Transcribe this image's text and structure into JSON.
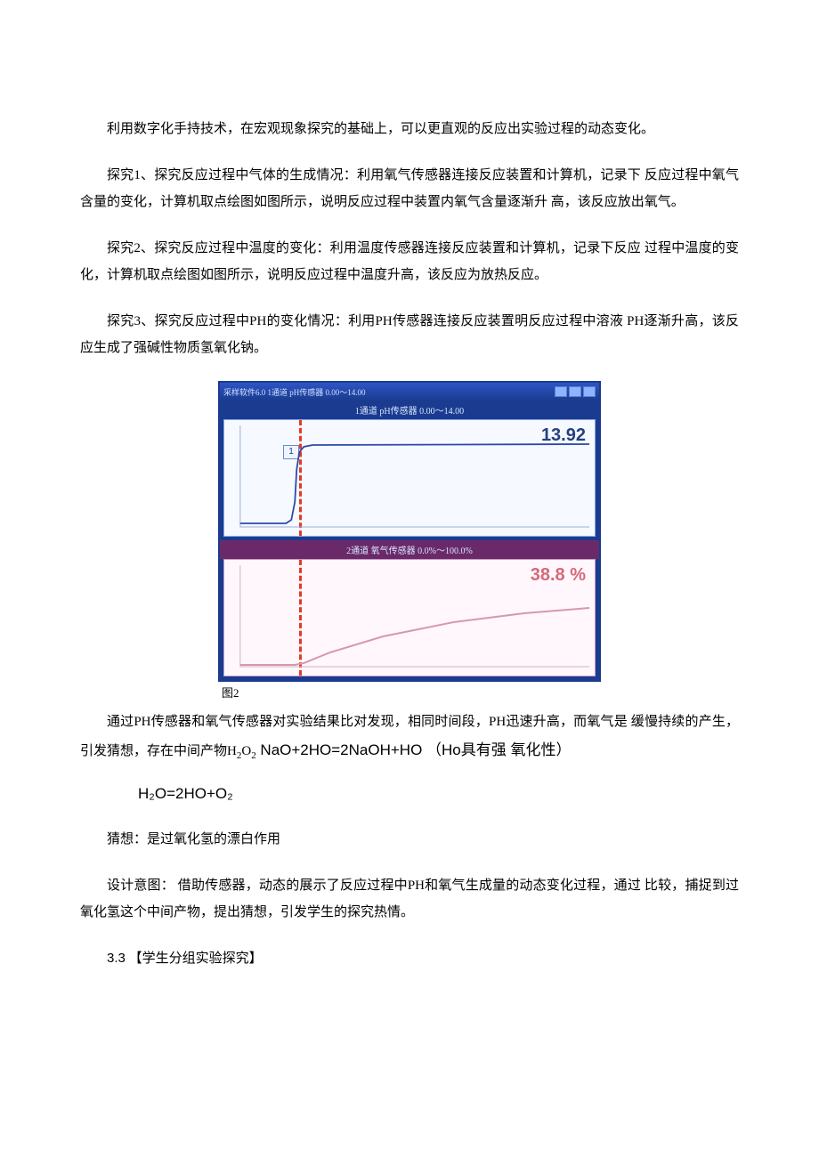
{
  "paras": {
    "p1": "利用数字化手持技术，在宏观现象探究的基础上，可以更直观的反应出实验过程的动态变化。",
    "p2": "探究1、探究反应过程中气体的生成情况：利用氧气传感器连接反应装置和计算机，记录下 反应过程中氧气含量的变化，计算机取点绘图如图所示，说明反应过程中装置内氧气含量逐渐升  高，该反应放出氧气。",
    "p3": "探究2、探究反应过程中温度的变化：利用温度传感器连接反应装置和计算机，记录下反应 过程中温度的变化，计算机取点绘图如图所示，说明反应过程中温度升高，该反应为放热反应。",
    "p4": "探究3、探究反应过程中PH的变化情况：利用PH传感器连接反应装置明反应过程中溶液 PH逐渐升高，该反应生成了强碱性物质氢氧化钠。",
    "fig_caption": "图2",
    "p5_a": "通过PH传感器和氧气传感器对实验结果比对发现，相同时间段，PH迅速升高，而氧气是 缓慢持续的产生，引发猜想，存在中间产物H",
    "p5_sub1": "2",
    "p5_mid": "O",
    "p5_sub2": "2",
    "p5_b": " NaO+2HO=2NaOH+HO （Ho具有强 氧化性）",
    "formula": "H₂O=2HO+O₂",
    "p6": "猜想：是过氧化氢的漂白作用",
    "p7": "设计意图： 借助传感器，动态的展示了反应过程中PH和氧气生成量的动态变化过程，通过 比较，捕捉到过氧化氢这个中间产物，提出猜想，引发学生的探究热情。",
    "sec_num": "3.3",
    "sec_title": " 【学生分组实验探究】"
  },
  "window": {
    "title": "采样软件6.0  1通道 pH传感器  0.00～14.00",
    "panel1": "1通道  pH传感器  0.00～14.00",
    "panel2": "2通道  氧气传感器  0.0%～100.0%",
    "marker": "1",
    "readout1": "13.92",
    "readout2": "38.8 %"
  },
  "chart_data": [
    {
      "type": "line",
      "title": "pH sensor",
      "ylabel": "pH",
      "ylim": [
        0,
        14
      ],
      "x": [
        0,
        60,
        70,
        80,
        85,
        90,
        100,
        420
      ],
      "values": [
        1.0,
        1.0,
        1.2,
        6.0,
        12.5,
        13.5,
        13.8,
        13.92
      ],
      "readout": 13.92
    },
    {
      "type": "line",
      "title": "O2 sensor",
      "ylabel": "O2 %",
      "ylim": [
        0,
        100
      ],
      "x": [
        0,
        80,
        90,
        120,
        180,
        260,
        340,
        420
      ],
      "values": [
        1,
        1,
        3,
        12,
        24,
        32,
        36,
        38.8
      ],
      "readout": 38.8
    }
  ]
}
